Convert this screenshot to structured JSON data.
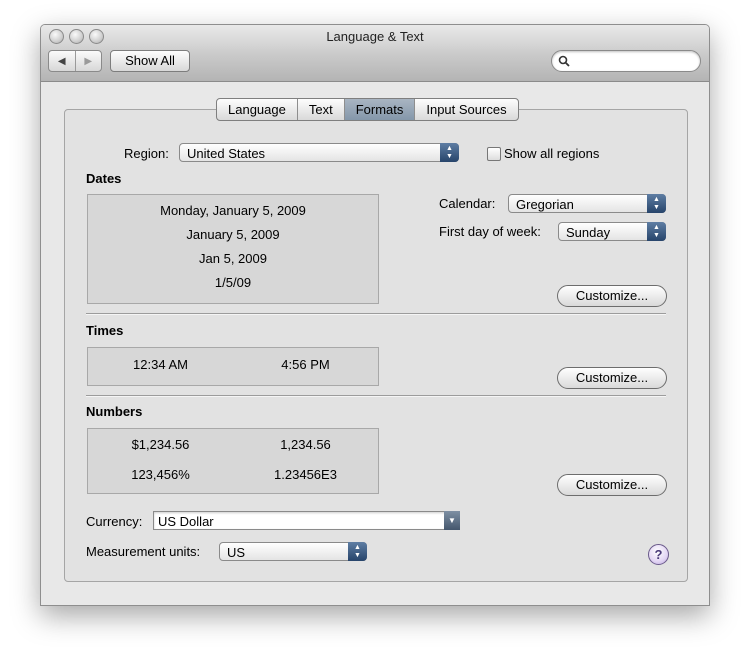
{
  "window": {
    "title": "Language & Text"
  },
  "toolbar": {
    "show_all_label": "Show All",
    "back_glyph": "◀",
    "forward_glyph": "▶",
    "search_value": ""
  },
  "tabs": [
    {
      "label": "Language",
      "selected": false
    },
    {
      "label": "Text",
      "selected": false
    },
    {
      "label": "Formats",
      "selected": true
    },
    {
      "label": "Input Sources",
      "selected": false
    }
  ],
  "region": {
    "label": "Region:",
    "value": "United States",
    "show_all_label": "Show all regions",
    "show_all_checked": false
  },
  "dates": {
    "heading": "Dates",
    "samples": [
      "Monday, January 5, 2009",
      "January 5, 2009",
      "Jan 5, 2009",
      "1/5/09"
    ],
    "calendar_label": "Calendar:",
    "calendar_value": "Gregorian",
    "first_day_label": "First day of week:",
    "first_day_value": "Sunday",
    "customize_label": "Customize..."
  },
  "times": {
    "heading": "Times",
    "short": "12:34 AM",
    "long": "4:56 PM",
    "customize_label": "Customize..."
  },
  "numbers": {
    "heading": "Numbers",
    "currency_sample": "$1,234.56",
    "decimal_sample": "1,234.56",
    "percent_sample": "123,456%",
    "scientific_sample": "1.23456E3",
    "customize_label": "Customize..."
  },
  "currency": {
    "label": "Currency:",
    "value": "US Dollar"
  },
  "measurement": {
    "label": "Measurement units:",
    "value": "US"
  },
  "help": {
    "glyph": "?"
  },
  "colors": {
    "selected_tab": "#8c9db0",
    "popup_arrow": "#3a5a85"
  }
}
